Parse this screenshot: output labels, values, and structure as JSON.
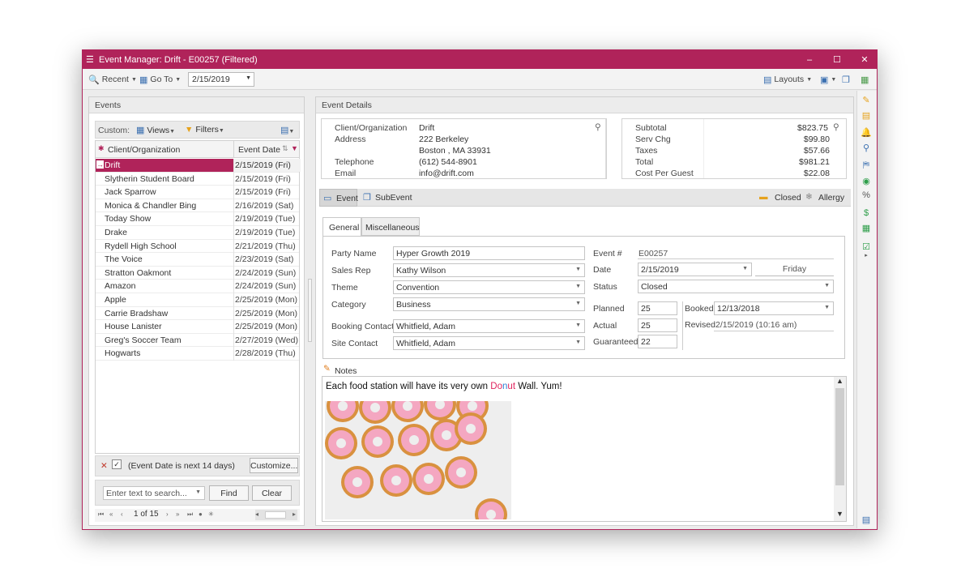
{
  "window": {
    "title": "Event Manager: Drift - E00257 (Filtered)",
    "minimize": "–",
    "maximize": "☐",
    "close": "✕"
  },
  "toolbar": {
    "recent": "Recent",
    "goto": "Go To",
    "date": "2/15/2019",
    "layouts": "Layouts"
  },
  "events_panel": {
    "header": "Events",
    "custom_label": "Custom:",
    "views": "Views",
    "filters": "Filters",
    "col_client": "Client/Organization",
    "col_date": "Event Date",
    "rows": [
      {
        "client": "Drift",
        "date": "2/15/2019 (Fri)"
      },
      {
        "client": "Slytherin Student Board",
        "date": "2/15/2019 (Fri)"
      },
      {
        "client": "Jack Sparrow",
        "date": "2/15/2019 (Fri)"
      },
      {
        "client": "Monica & Chandler Bing",
        "date": "2/16/2019 (Sat)"
      },
      {
        "client": "Today Show",
        "date": "2/19/2019 (Tue)"
      },
      {
        "client": "Drake",
        "date": "2/19/2019 (Tue)"
      },
      {
        "client": "Rydell High School",
        "date": "2/21/2019 (Thu)"
      },
      {
        "client": "The Voice",
        "date": "2/23/2019 (Sat)"
      },
      {
        "client": "Stratton Oakmont",
        "date": "2/24/2019 (Sun)"
      },
      {
        "client": "Amazon",
        "date": "2/24/2019 (Sun)"
      },
      {
        "client": "Apple",
        "date": "2/25/2019 (Mon)"
      },
      {
        "client": "Carrie Bradshaw",
        "date": "2/25/2019 (Mon)"
      },
      {
        "client": "House Lanister",
        "date": "2/25/2019 (Mon)"
      },
      {
        "client": "Greg's Soccer Team",
        "date": "2/27/2019 (Wed)"
      },
      {
        "client": "Hogwarts",
        "date": "2/28/2019 (Thu)"
      }
    ],
    "filter_text": "(Event Date is next 14 days)",
    "customize": "Customize...",
    "search_placeholder": "Enter text to search...",
    "find": "Find",
    "clear": "Clear",
    "pager": "1 of 15"
  },
  "details": {
    "header": "Event Details",
    "client_label": "Client/Organization",
    "client": "Drift",
    "address_label": "Address",
    "address1": "222 Berkeley",
    "address2": "Boston , MA 33931",
    "telephone_label": "Telephone",
    "telephone": "(612) 544-8901",
    "email_label": "Email",
    "email": "info@drift.com",
    "totals": [
      {
        "label": "Subtotal",
        "value": "$823.75"
      },
      {
        "label": "Serv Chg",
        "value": "$99.80"
      },
      {
        "label": "Taxes",
        "value": "$57.66"
      },
      {
        "label": "Total",
        "value": "$981.21"
      },
      {
        "label": "Cost Per Guest",
        "value": "$22.08"
      }
    ],
    "tab_event": "Event",
    "tab_subevent": "SubEvent",
    "closed": "Closed",
    "allergy": "Allergy",
    "subtab_general": "General",
    "subtab_misc": "Miscellaneous",
    "party_name_label": "Party Name",
    "party_name": "Hyper Growth 2019",
    "sales_rep_label": "Sales Rep",
    "sales_rep": "Kathy Wilson",
    "theme_label": "Theme",
    "theme": "Convention",
    "category_label": "Category",
    "category": "Business",
    "booking_contact_label": "Booking Contact",
    "booking_contact": "Whitfield, Adam",
    "site_contact_label": "Site Contact",
    "site_contact": "Whitfield, Adam",
    "event_no_label": "Event #",
    "event_no": "E00257",
    "date_label": "Date",
    "date": "2/15/2019",
    "weekday": "Friday",
    "status_label": "Status",
    "status": "Closed",
    "planned_label": "Planned",
    "planned": "25",
    "actual_label": "Actual",
    "actual": "25",
    "guaranteed_label": "Guaranteed",
    "guaranteed": "22",
    "booked_label": "Booked",
    "booked": "12/13/2018",
    "revised_label": "Revised",
    "revised": "2/15/2019 (10:16 am)",
    "notes_label": "Notes",
    "notes_pre": "Each food station will have its very own ",
    "notes_donut": "Donut",
    "notes_post": " Wall. Yum!"
  },
  "colors": {
    "accent": "#b0235a",
    "donut_d": "#e0245e",
    "donut_t": "#2e7fd6"
  }
}
